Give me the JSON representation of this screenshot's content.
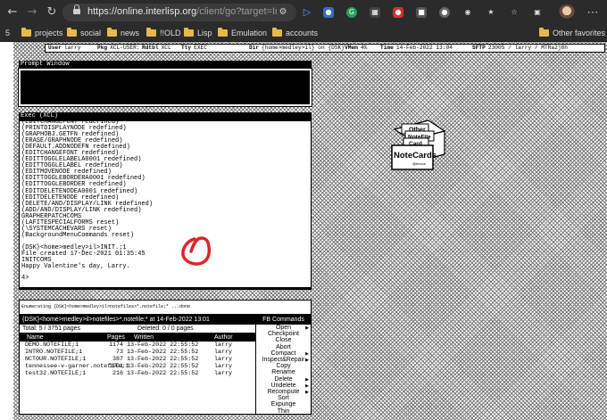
{
  "browser": {
    "url_host": "https://online.interlisp.org",
    "url_path": "/client/go?target=Interlis...",
    "bookmarks": [
      "projects",
      "social",
      "news",
      "!!OLD",
      "Lisp",
      "Emulation",
      "accounts"
    ],
    "other_favorites": "Other favorites",
    "icons": [
      "back-arrow-icon",
      "forward-arrow-icon",
      "refresh-icon",
      "lock-icon",
      "more-icon"
    ]
  },
  "status": {
    "user_label": "User",
    "user_value": "larry",
    "pkg_label": "Pkg",
    "pkg_value": "XCL-USER:",
    "rdtbl_label": "Rdtbl",
    "rdtbl_value": "XCL",
    "tty_label": "Tty",
    "tty_value": "EXEC",
    "dir_label": "Dir",
    "dir_value": "{home>medley>il} on {DSK}",
    "vmem_label": "VMem",
    "vmem_value": "4%",
    "time_label": "Time",
    "time_value": "14-Feb-2022 13:04",
    "sftp_label": "SFTP",
    "sftp_value": "23005 / larry / MTRa2j8h"
  },
  "prompt_window": {
    "title": "Prompt Window"
  },
  "exec": {
    "title": "Exec (XCL)",
    "lines": [
      "(EDITCHANGEFONT redefined)",
      "(PRINTDISPLAYNODE redefined)",
      "(GRAPHOBJ.GETFN redefined)",
      "(ERASE/GRAPHNODE redefined)",
      "(DEFAULT.ADDNODEFN redefined)",
      "(EDITCHANGEFONT redefined)",
      "(EDITTOGGLELABELA0001 redefined)",
      "(EDITTOGGLELABEL redefined)",
      "(EDITMOVENODE redefined)",
      "(EDITTOGGLEBORDERA0001 redefined)",
      "(EDITTOGGLEBORDER redefined)",
      "(EDITDELETENODEA0001 redefined)",
      "(EDITDELETENODE redefined)",
      "(DELETE/AND/DISPLAY/LINK redefined)",
      "(ADD/AND/DISPLAY/LINK redefined)",
      "GRAPHERPATCHCOMS",
      "(LAFITESPECIALFORMS reset)",
      "(\\SYSTEMCACHEVARS reset)",
      "(BackgroundMenuCommands reset)",
      "",
      "{DSK}<home>medley>il>INIT.;1",
      "File created 17-Dec-2021 01:35:45",
      "INITCOMS",
      "Happy Valentine's day, Larry."
    ],
    "prompt": "4>"
  },
  "notecards_icon": {
    "tab_other": "Other",
    "tab_notefile": "NoteFile",
    "tab_card": "Card",
    "label": "NoteCards",
    "sublabel": "@envos"
  },
  "enumerating": "Enumerating {DSK}<home>medley>il>notefiles>*.notefile;* ...done",
  "file_browser": {
    "title": "{DSK}<home>medley>il>notefiles>*.notefile;*   at 14-Feb-2022 13:01",
    "commands_title": "FB Commands",
    "total": "Total: 5 / 3751 pages",
    "deleted": "Deleted: 0 / 0 pages",
    "columns": [
      "Name",
      "Pages",
      "Written",
      "Author"
    ],
    "rows": [
      [
        "DEMO.NOTEFILE;1",
        "1174",
        "13-Feb-2022 22:55:52",
        "larry"
      ],
      [
        "INTRO.NOTEFILE;1",
        "73",
        "13-Feb-2022 22:55:52",
        "larry"
      ],
      [
        "NCTOUR.NOTEFILE;1",
        "387",
        "13-Feb-2022 22:55:52",
        "larry"
      ],
      [
        "tennessee-v-garner.notefile;1",
        "1901",
        "13-Feb-2022 22:55:52",
        "larry"
      ],
      [
        "test32.NOTEFILE;1",
        "216",
        "13-Feb-2022 22:55:52",
        "larry"
      ]
    ],
    "commands": [
      {
        "label": "Open",
        "submenu": true
      },
      {
        "label": "Checkpoint",
        "submenu": false
      },
      {
        "label": "Close",
        "submenu": false
      },
      {
        "label": "Abort",
        "submenu": false
      },
      {
        "label": "Compact",
        "submenu": true
      },
      {
        "label": "Inspect&Repair",
        "submenu": true
      },
      {
        "label": "Copy",
        "submenu": false
      },
      {
        "label": "Rename",
        "submenu": false
      },
      {
        "label": "Delete",
        "submenu": true
      },
      {
        "label": "Undelete",
        "submenu": true
      },
      {
        "label": "Recompute",
        "submenu": true
      },
      {
        "label": "Sort",
        "submenu": false
      },
      {
        "label": "Expunge",
        "submenu": false
      },
      {
        "label": "Thin",
        "submenu": false
      }
    ]
  }
}
